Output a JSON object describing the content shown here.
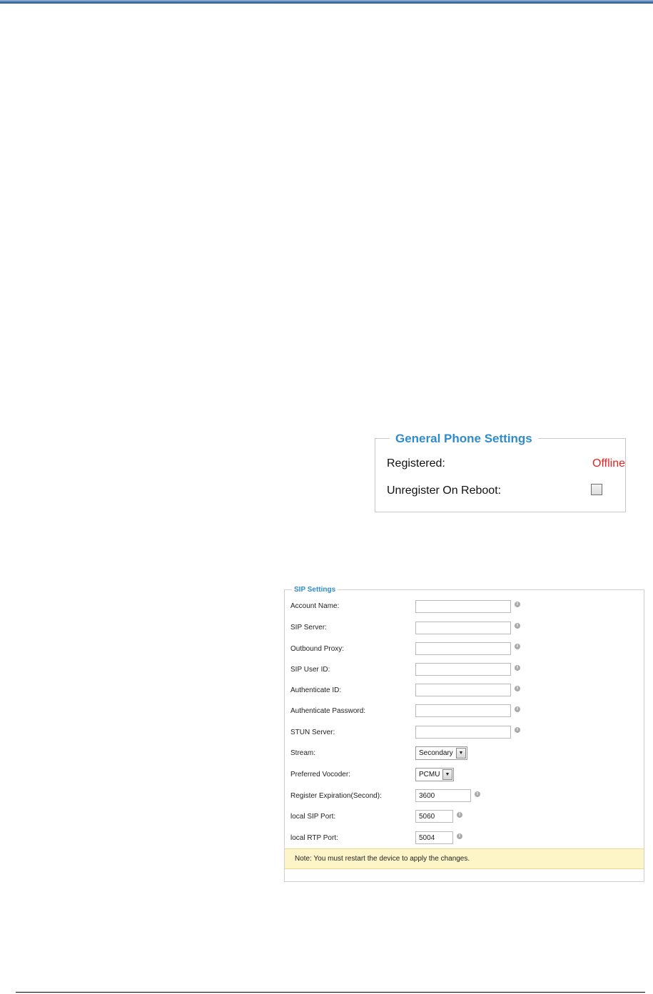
{
  "general_phone_settings": {
    "title": "General Phone Settings",
    "registered_label": "Registered:",
    "registered_value": "Offline",
    "unregister_label": "Unregister On Reboot:",
    "unregister_checked": false
  },
  "sip_settings": {
    "title": "SIP Settings",
    "fields": {
      "account_name": {
        "label": "Account Name:",
        "value": ""
      },
      "sip_server": {
        "label": "SIP Server:",
        "value": ""
      },
      "outbound_proxy": {
        "label": "Outbound Proxy:",
        "value": ""
      },
      "sip_user_id": {
        "label": "SIP User ID:",
        "value": ""
      },
      "authenticate_id": {
        "label": "Authenticate ID:",
        "value": ""
      },
      "authenticate_password": {
        "label": "Authenticate Password:",
        "value": ""
      },
      "stun_server": {
        "label": "STUN Server:",
        "value": ""
      },
      "stream": {
        "label": "Stream:",
        "value": "Secondary"
      },
      "preferred_vocoder": {
        "label": "Preferred Vocoder:",
        "value": "PCMU"
      },
      "register_expiration": {
        "label": "Register Expiration(Second):",
        "value": "3600"
      },
      "local_sip_port": {
        "label": "local SIP Port:",
        "value": "5060"
      },
      "local_rtp_port": {
        "label": "local RTP Port:",
        "value": "5004"
      }
    },
    "note": "Note: You must restart the device to apply the changes."
  },
  "colors": {
    "accent": "#2f8ccc",
    "offline": "#e32222",
    "note_background": "#fdf5c8"
  },
  "icons": {
    "info": "info-icon",
    "dropdown": "chevron-down-icon"
  }
}
